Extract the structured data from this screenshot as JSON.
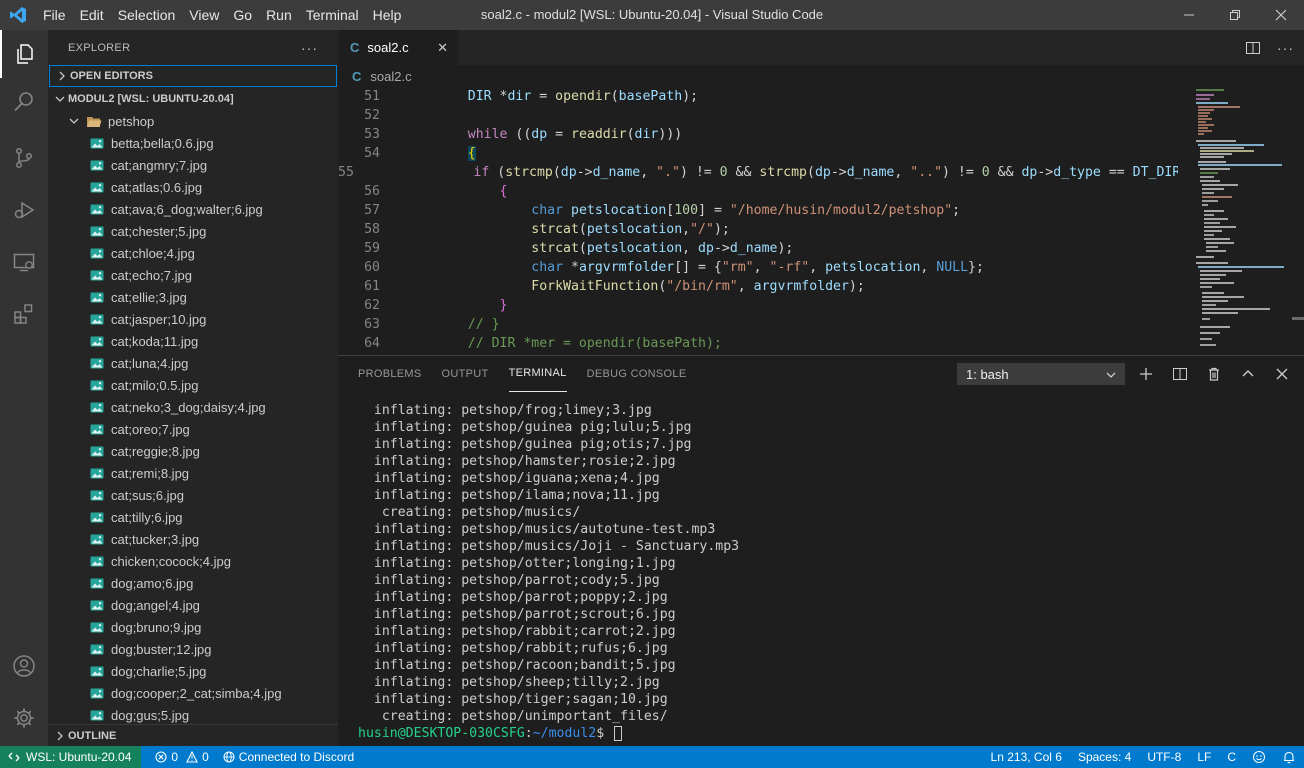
{
  "window": {
    "title": "soal2.c - modul2 [WSL: Ubuntu-20.04] - Visual Studio Code",
    "menu": [
      "File",
      "Edit",
      "Selection",
      "View",
      "Go",
      "Run",
      "Terminal",
      "Help"
    ]
  },
  "sidebar": {
    "header": "EXPLORER",
    "open_editors": "OPEN EDITORS",
    "workspace": "MODUL2 [WSL: UBUNTU-20.04]",
    "folder": "petshop",
    "files": [
      "betta;bella;0.6.jpg",
      "cat;angmry;7.jpg",
      "cat;atlas;0.6.jpg",
      "cat;ava;6_dog;walter;6.jpg",
      "cat;chester;5.jpg",
      "cat;chloe;4.jpg",
      "cat;echo;7.jpg",
      "cat;ellie;3.jpg",
      "cat;jasper;10.jpg",
      "cat;koda;11.jpg",
      "cat;luna;4.jpg",
      "cat;milo;0.5.jpg",
      "cat;neko;3_dog;daisy;4.jpg",
      "cat;oreo;7.jpg",
      "cat;reggie;8.jpg",
      "cat;remi;8.jpg",
      "cat;sus;6.jpg",
      "cat;tilly;6.jpg",
      "cat;tucker;3.jpg",
      "chicken;cocock;4.jpg",
      "dog;amo;6.jpg",
      "dog;angel;4.jpg",
      "dog;bruno;9.jpg",
      "dog;buster;12.jpg",
      "dog;charlie;5.jpg",
      "dog;cooper;2_cat;simba;4.jpg",
      "dog;gus;5.jpg"
    ],
    "outline": "OUTLINE"
  },
  "editor": {
    "tab_label": "soal2.c",
    "breadcrumb": "soal2.c",
    "line_numbers": [
      "51",
      "52",
      "53",
      "54",
      "55",
      "56",
      "57",
      "58",
      "59",
      "60",
      "61",
      "62",
      "63",
      "64"
    ]
  },
  "panel": {
    "tabs": [
      "PROBLEMS",
      "OUTPUT",
      "TERMINAL",
      "DEBUG CONSOLE"
    ],
    "terminal_select": "1: bash",
    "lines": [
      "  inflating: petshop/frog;limey;3.jpg",
      "  inflating: petshop/guinea pig;lulu;5.jpg",
      "  inflating: petshop/guinea pig;otis;7.jpg",
      "  inflating: petshop/hamster;rosie;2.jpg",
      "  inflating: petshop/iguana;xena;4.jpg",
      "  inflating: petshop/ilama;nova;11.jpg",
      "   creating: petshop/musics/",
      "  inflating: petshop/musics/autotune-test.mp3",
      "  inflating: petshop/musics/Joji - Sanctuary.mp3",
      "  inflating: petshop/otter;longing;1.jpg",
      "  inflating: petshop/parrot;cody;5.jpg",
      "  inflating: petshop/parrot;poppy;2.jpg",
      "  inflating: petshop/parrot;scrout;6.jpg",
      "  inflating: petshop/rabbit;carrot;2.jpg",
      "  inflating: petshop/rabbit;rufus;6.jpg",
      "  inflating: petshop/racoon;bandit;5.jpg",
      "  inflating: petshop/sheep;tilly;2.jpg",
      "  inflating: petshop/tiger;sagan;10.jpg",
      "   creating: petshop/unimportant_files/"
    ],
    "prompt_user": "husin@DESKTOP-030CSFG",
    "prompt_path": "~/modul2",
    "prompt_suffix": "$ "
  },
  "statusbar": {
    "remote": "WSL: Ubuntu-20.04",
    "errors": "0",
    "warnings": "0",
    "discord": "Connected to Discord",
    "position": "Ln 213, Col 6",
    "spaces": "Spaces: 4",
    "encoding": "UTF-8",
    "eol": "LF",
    "language": "C"
  },
  "colors": {
    "accent": "#007acc",
    "remote": "#16825d",
    "activity_bar": "#333333",
    "sidebar": "#252526",
    "editor": "#1e1e1e"
  }
}
